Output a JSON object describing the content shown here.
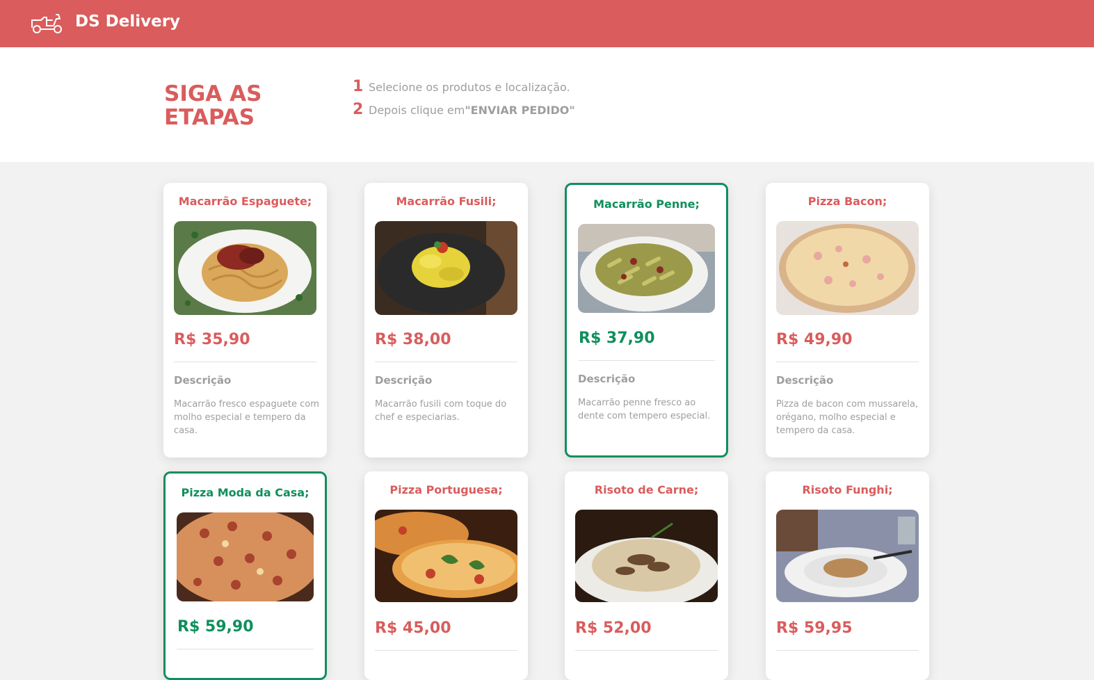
{
  "app": {
    "brand": "DS Delivery",
    "logo_icon": "scooter-icon"
  },
  "steps": {
    "title": "SIGA AS ETAPAS",
    "items": [
      {
        "number": "1",
        "text": "Selecione os produtos e localização.",
        "strong": ""
      },
      {
        "number": "2",
        "text": "Depois clique em ",
        "strong": "\"ENVIAR PEDIDO\""
      }
    ]
  },
  "colors": {
    "primary": "#DA5C5C",
    "selected": "#0F8F5D",
    "muted": "#9E9E9E",
    "background": "#F2F2F2"
  },
  "products": [
    {
      "name": "Macarrão Espaguete;",
      "price": "R$ 35,90",
      "description_title": "Descrição",
      "description": "Macarrão fresco espaguete com molho especial e tempero da casa.",
      "selected": false,
      "image": "spaghetti-image"
    },
    {
      "name": "Macarrão Fusili;",
      "price": "R$ 38,00",
      "description_title": "Descrição",
      "description": "Macarrão fusili com toque do chef e especiarias.",
      "selected": false,
      "image": "fusilli-image"
    },
    {
      "name": "Macarrão Penne;",
      "price": "R$ 37,90",
      "description_title": "Descrição",
      "description": "Macarrão penne fresco ao dente com tempero especial.",
      "selected": true,
      "image": "penne-image"
    },
    {
      "name": "Pizza Bacon;",
      "price": "R$ 49,90",
      "description_title": "Descrição",
      "description": "Pizza de bacon com mussarela, orégano, molho especial e tempero da casa.",
      "selected": false,
      "image": "pizza-bacon-image"
    },
    {
      "name": "Pizza Moda da Casa;",
      "price": "R$ 59,90",
      "selected": true,
      "image": "pizza-moda-image"
    },
    {
      "name": "Pizza Portuguesa;",
      "price": "R$ 45,00",
      "selected": false,
      "image": "pizza-portuguesa-image"
    },
    {
      "name": "Risoto de Carne;",
      "price": "R$ 52,00",
      "selected": false,
      "image": "risotto-carne-image"
    },
    {
      "name": "Risoto Funghi;",
      "price": "R$ 59,95",
      "selected": false,
      "image": "risotto-funghi-image"
    }
  ]
}
